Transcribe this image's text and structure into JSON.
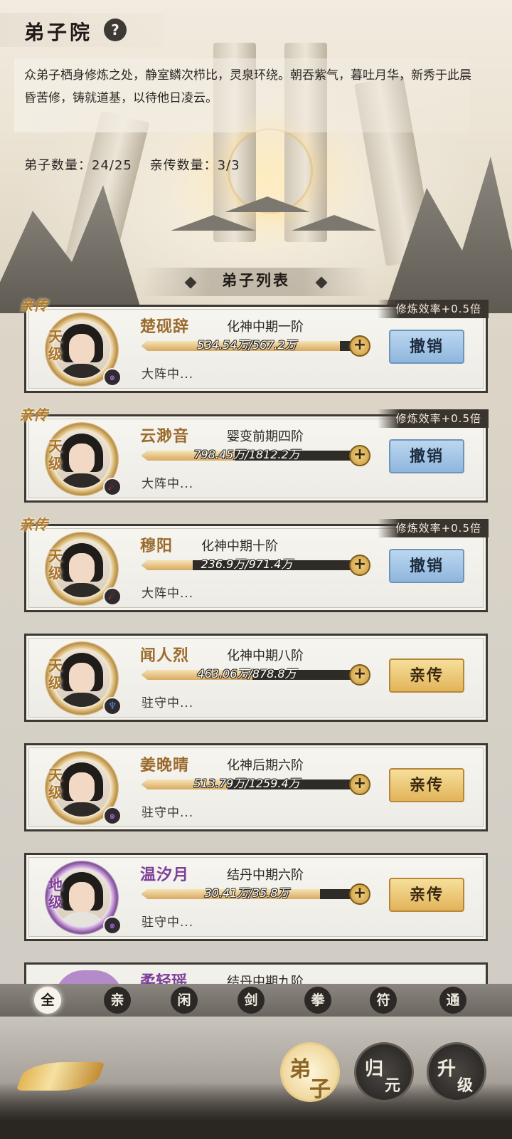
{
  "header": {
    "title": "弟子院",
    "help_icon": "?",
    "intro": "众弟子栖身修炼之处，静室鳞次栉比，灵泉环绕。朝吞紫气，暮吐月华，新秀于此晨昏苦修，铸就道基，以待他日凌云。",
    "disciple_count": "弟子数量：24/25",
    "core_count": "亲传数量：3/3"
  },
  "list_title": "弟子列表",
  "disciples": [
    {
      "tag": "亲传",
      "boost": "修炼效率+0.5倍",
      "grade": "天级",
      "name": "楚砚辞",
      "realm": "化神中期一阶",
      "progress_text": "534.54万/567.2万",
      "progress": 0.942,
      "task": "大阵中...",
      "action": "撤销",
      "element_icon": "wind-icon"
    },
    {
      "tag": "亲传",
      "boost": "修炼效率+0.5倍",
      "grade": "天级",
      "name": "云渺音",
      "realm": "婴变前期四阶",
      "progress_text": "798.45万/1812.2万",
      "progress": 0.441,
      "task": "大阵中...",
      "action": "撤销",
      "element_icon": "flame-icon"
    },
    {
      "tag": "亲传",
      "boost": "修炼效率+0.5倍",
      "grade": "天级",
      "name": "穆阳",
      "realm": "化神中期十阶",
      "progress_text": "236.9万/971.4万",
      "progress": 0.244,
      "task": "大阵中...",
      "action": "撤销",
      "element_icon": "flame-icon"
    },
    {
      "tag": "",
      "boost": "",
      "grade": "天级",
      "name": "闻人烈",
      "realm": "化神中期八阶",
      "progress_text": "463.06万/878.8万",
      "progress": 0.527,
      "task": "驻守中...",
      "action": "亲传",
      "element_icon": "water-icon"
    },
    {
      "tag": "",
      "boost": "",
      "grade": "天级",
      "name": "姜晚晴",
      "realm": "化神后期六阶",
      "progress_text": "513.79万/1259.4万",
      "progress": 0.408,
      "task": "驻守中...",
      "action": "亲传",
      "element_icon": "wind-icon"
    },
    {
      "tag": "",
      "boost": "",
      "grade": "地级",
      "name": "温汐月",
      "realm": "结丹中期六阶",
      "progress_text": "30.41万/35.8万",
      "progress": 0.849,
      "task": "驻守中...",
      "action": "亲传",
      "element_icon": "wind-icon"
    }
  ],
  "partial_card": {
    "name": "柔轻瑶",
    "realm": "结丹中期九阶"
  },
  "filters": [
    "全",
    "亲",
    "闲",
    "剑",
    "拳",
    "符",
    "通"
  ],
  "bottom_nav": [
    {
      "a": "弟",
      "b": "子"
    },
    {
      "a": "归",
      "b": "元"
    },
    {
      "a": "升",
      "b": "级"
    }
  ],
  "colors": {
    "accent_gold": "#9a6b2d",
    "earth_purple": "#7c3f9a",
    "revoke_blue": "#8fb6dd",
    "promote_gold": "#e2b45a"
  }
}
